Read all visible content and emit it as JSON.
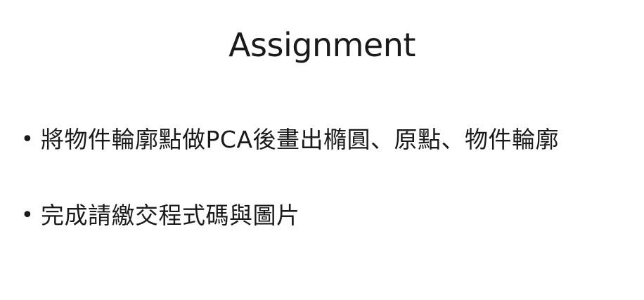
{
  "slide": {
    "title": "Assignment",
    "bullet_symbol": "•",
    "bullets": [
      {
        "text": "將物件輪廓點做PCA後畫出橢圓、原點、物件輪廓"
      },
      {
        "text": "完成請繳交程式碼與圖片"
      }
    ]
  }
}
